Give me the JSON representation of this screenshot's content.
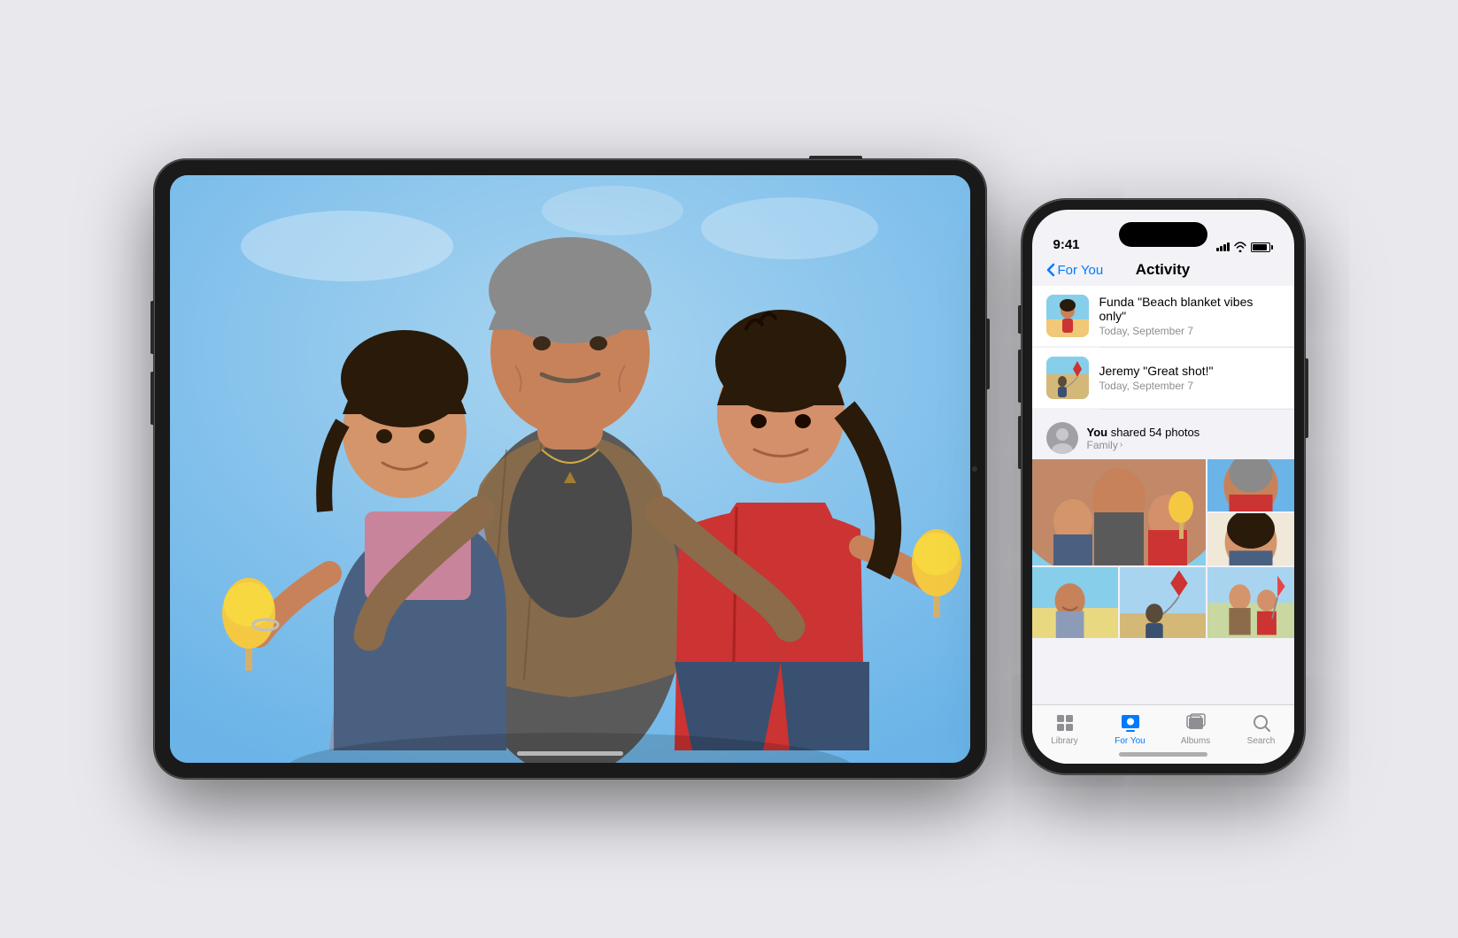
{
  "scene": {
    "background": "#e8e8ed"
  },
  "ipad": {
    "content": "Family photo showing father and two daughters with ice cream/popsicles against blue sky"
  },
  "iphone": {
    "status_bar": {
      "time": "9:41",
      "signal": "●●●●",
      "wifi": "WiFi",
      "battery": "100%"
    },
    "nav": {
      "back_label": "For You",
      "title": "Activity"
    },
    "activity_items": [
      {
        "name": "Funda",
        "comment": "\"Beach blanket vibes only\"",
        "date": "Today, September 7",
        "thumb": "beach_photo"
      },
      {
        "name": "Jeremy",
        "comment": "\"Great shot!\"",
        "date": "Today, September 7",
        "thumb": "kite_photo"
      }
    ],
    "shared_section": {
      "user": "You",
      "action": "shared 54 photos",
      "album": "Family",
      "avatar": "you_avatar"
    },
    "tab_bar": {
      "items": [
        {
          "label": "Library",
          "icon": "library-icon",
          "active": false
        },
        {
          "label": "For You",
          "icon": "for-you-icon",
          "active": true
        },
        {
          "label": "Albums",
          "icon": "albums-icon",
          "active": false
        },
        {
          "label": "Search",
          "icon": "search-icon",
          "active": false
        }
      ]
    }
  }
}
